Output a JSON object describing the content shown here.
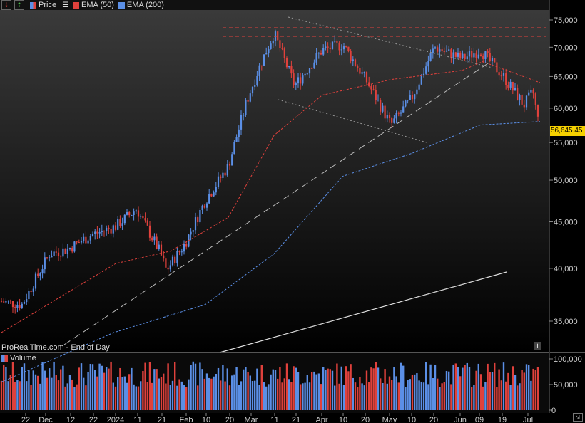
{
  "toolbar": {
    "price_label": "Price",
    "ema50_label": "EMA (50)",
    "ema200_label": "EMA (200)"
  },
  "volume_label": "Volume",
  "watermark": "ProRealTime.com - End of Day",
  "last_price": "56,645.45",
  "colors": {
    "up": "#5b8fe6",
    "down": "#e0413c",
    "ema50": "#e0413c",
    "ema200": "#5b8fe6",
    "background": "#000000",
    "price_flag": "#f5d000"
  },
  "chart_data": {
    "type": "candlestick",
    "y_axis": {
      "scale": "log",
      "range": [
        33000,
        77000
      ],
      "ticks": [
        "35,000",
        "40,000",
        "45,000",
        "50,000",
        "55,000",
        "60,000",
        "65,000",
        "70,000",
        "75,000"
      ]
    },
    "x_tick_labels": [
      "22",
      "Dec",
      "12",
      "22",
      "2024",
      "11",
      "21",
      "Feb",
      "10",
      "20",
      "Mar",
      "11",
      "21",
      "Apr",
      "10",
      "20",
      "May",
      "10",
      "20",
      "Jun",
      "09",
      "19",
      "Jul"
    ],
    "close_path": [
      {
        "date": "2023-11-13",
        "value": 36800
      },
      {
        "date": "2023-11-22",
        "value": 36500
      },
      {
        "date": "2023-12-04",
        "value": 41500
      },
      {
        "date": "2023-12-12",
        "value": 42000
      },
      {
        "date": "2023-12-22",
        "value": 43500
      },
      {
        "date": "2024-01-02",
        "value": 44500
      },
      {
        "date": "2024-01-11",
        "value": 46500
      },
      {
        "date": "2024-01-21",
        "value": 41800
      },
      {
        "date": "2024-01-24",
        "value": 39800
      },
      {
        "date": "2024-02-01",
        "value": 42500
      },
      {
        "date": "2024-02-10",
        "value": 47500
      },
      {
        "date": "2024-02-20",
        "value": 51800
      },
      {
        "date": "2024-02-28",
        "value": 61000
      },
      {
        "date": "2024-03-05",
        "value": 67000
      },
      {
        "date": "2024-03-11",
        "value": 72500
      },
      {
        "date": "2024-03-20",
        "value": 63500
      },
      {
        "date": "2024-04-01",
        "value": 69500
      },
      {
        "date": "2024-04-10",
        "value": 70500
      },
      {
        "date": "2024-04-20",
        "value": 64500
      },
      {
        "date": "2024-05-01",
        "value": 57500
      },
      {
        "date": "2024-05-10",
        "value": 61500
      },
      {
        "date": "2024-05-20",
        "value": 70000
      },
      {
        "date": "2024-06-01",
        "value": 68000
      },
      {
        "date": "2024-06-09",
        "value": 69500
      },
      {
        "date": "2024-06-19",
        "value": 65000
      },
      {
        "date": "2024-06-28",
        "value": 60500
      },
      {
        "date": "2024-07-02",
        "value": 62500
      },
      {
        "date": "2024-07-05",
        "value": 56645
      }
    ],
    "ema50": [
      {
        "date": "2023-11-13",
        "value": 34000
      },
      {
        "date": "2024-01-02",
        "value": 40500
      },
      {
        "date": "2024-01-26",
        "value": 41800
      },
      {
        "date": "2024-02-20",
        "value": 45500
      },
      {
        "date": "2024-03-11",
        "value": 56000
      },
      {
        "date": "2024-04-01",
        "value": 62000
      },
      {
        "date": "2024-05-01",
        "value": 64500
      },
      {
        "date": "2024-06-01",
        "value": 66000
      },
      {
        "date": "2024-06-10",
        "value": 67500
      },
      {
        "date": "2024-07-05",
        "value": 64000
      }
    ],
    "ema200": [
      {
        "date": "2023-11-13",
        "value": 30000
      },
      {
        "date": "2024-01-01",
        "value": 34000
      },
      {
        "date": "2024-02-10",
        "value": 36500
      },
      {
        "date": "2024-03-11",
        "value": 41500
      },
      {
        "date": "2024-04-10",
        "value": 50500
      },
      {
        "date": "2024-05-10",
        "value": 53500
      },
      {
        "date": "2024-06-09",
        "value": 57500
      },
      {
        "date": "2024-07-05",
        "value": 58000
      }
    ],
    "volume_axis": {
      "range": [
        0,
        110000
      ],
      "ticks": [
        "0",
        "50,000",
        "100,000"
      ]
    }
  }
}
